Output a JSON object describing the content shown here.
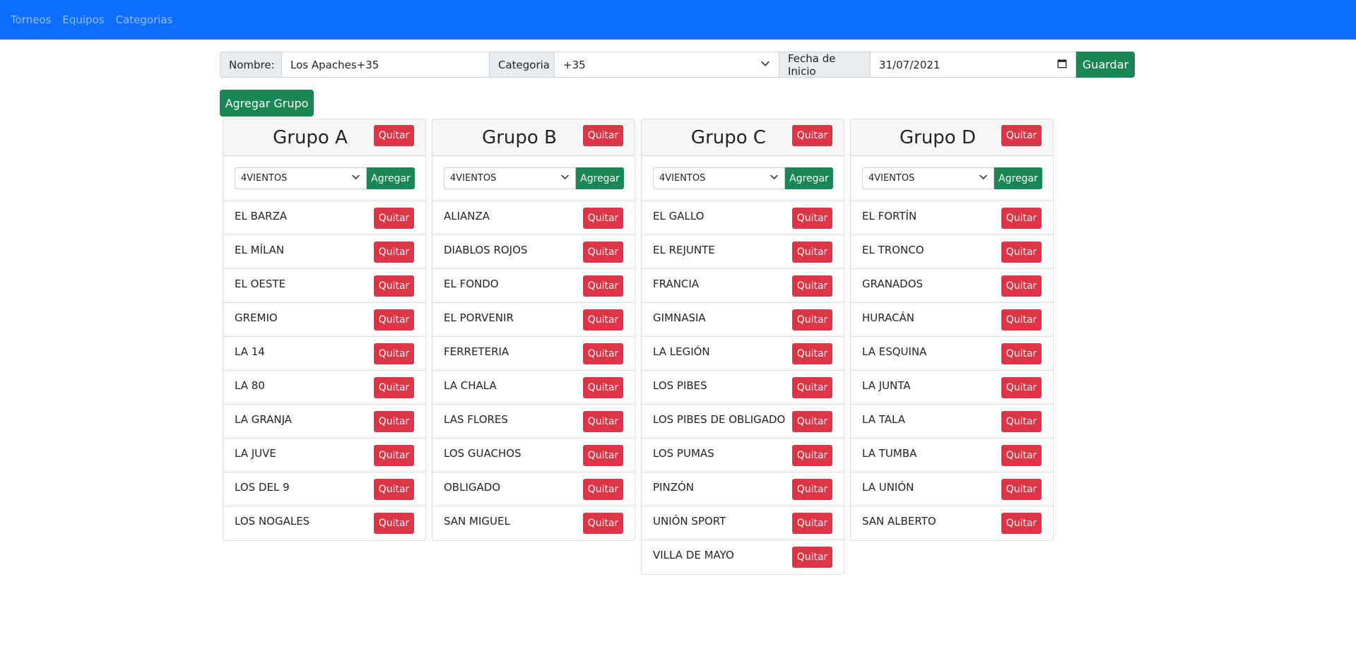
{
  "nav": {
    "items": [
      "Torneos",
      "Equipos",
      "Categorias"
    ]
  },
  "form": {
    "nombre_label": "Nombre:",
    "nombre_value": "Los Apaches+35",
    "categoria_label": "Categoria",
    "categoria_value": "+35",
    "fecha_label": "Fecha de Inicio",
    "fecha_value": "31/07/2021",
    "guardar_label": "Guardar",
    "agregar_grupo_label": "Agregar Grupo"
  },
  "quitar_label": "Quitar",
  "agregar_label": "Agregar",
  "groups": [
    {
      "title": "Grupo A",
      "select_value": "4VIENTOS",
      "teams": [
        "EL BARZA",
        "EL MÍLAN",
        "EL OESTE",
        "GREMIO",
        "LA 14",
        "LA 80",
        "LA GRANJA",
        "LA JUVE",
        "LOS DEL 9",
        "LOS NOGALES"
      ]
    },
    {
      "title": "Grupo B",
      "select_value": "4VIENTOS",
      "teams": [
        "ALIANZA",
        "DIABLOS ROJOS",
        "EL FONDO",
        "EL PORVENIR",
        "FERRETERIA",
        "LA CHALA",
        "LAS FLORES",
        "LOS GUACHOS",
        "OBLIGADO",
        "SAN MIGUEL"
      ]
    },
    {
      "title": "Grupo C",
      "select_value": "4VIENTOS",
      "teams": [
        "EL GALLO",
        "EL REJUNTE",
        "FRANCIA",
        "GIMNASIA",
        "LA LEGIÓN",
        "LOS PIBES",
        "LOS PIBES DE OBLIGADO",
        "LOS PUMAS",
        "PINZÓN",
        "UNIÓN SPORT",
        "VILLA DE MAYO"
      ]
    },
    {
      "title": "Grupo D",
      "select_value": "4VIENTOS",
      "teams": [
        "EL FORTÍN",
        "EL TRONCO",
        "GRANADOS",
        "HURACÁN",
        "LA ESQUINA",
        "LA JUNTA",
        "LA TALA",
        "LA TUMBA",
        "LA UNIÓN",
        "SAN ALBERTO"
      ]
    }
  ]
}
